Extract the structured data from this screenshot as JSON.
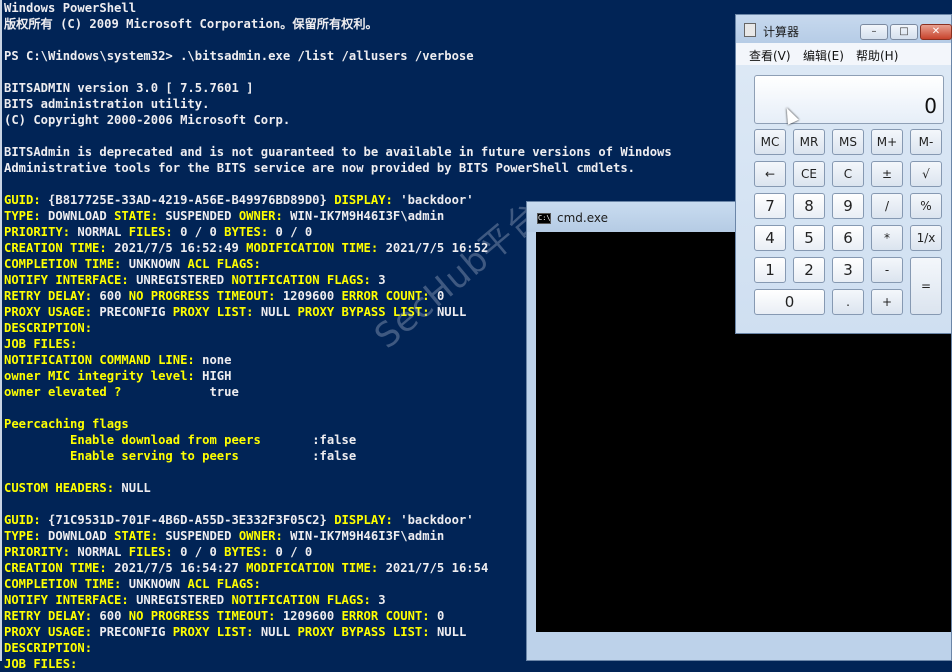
{
  "watermark": "SecHub平台",
  "powershell": {
    "lines": [
      "Windows PowerShell",
      "版权所有 (C) 2009 Microsoft Corporation。保留所有权利。",
      "",
      "PS C:\\Windows\\system32> .\\bitsadmin.exe /list /allusers /verbose",
      "",
      "BITSADMIN version 3.0 [ 7.5.7601 ]",
      "BITS administration utility.",
      "(C) Copyright 2000-2006 Microsoft Corp.",
      "",
      "BITSAdmin is deprecated and is not guaranteed to be available in future versions of Windows",
      "Administrative tools for the BITS service are now provided by BITS PowerShell cmdlets.",
      "",
      "GUID: {B817725E-33AD-4219-A56E-B49976BD89D0} DISPLAY: 'backdoor'",
      "TYPE: DOWNLOAD STATE: SUSPENDED OWNER: WIN-IK7M9H46I3F\\admin",
      "PRIORITY: NORMAL FILES: 0 / 0 BYTES: 0 / 0",
      "CREATION TIME: 2021/7/5 16:52:49 MODIFICATION TIME: 2021/7/5 16:52",
      "COMPLETION TIME: UNKNOWN ACL FLAGS:",
      "NOTIFY INTERFACE: UNREGISTERED NOTIFICATION FLAGS: 3",
      "RETRY DELAY: 600 NO PROGRESS TIMEOUT: 1209600 ERROR COUNT: 0",
      "PROXY USAGE: PRECONFIG PROXY LIST: NULL PROXY BYPASS LIST: NULL",
      "DESCRIPTION:",
      "JOB FILES:",
      "NOTIFICATION COMMAND LINE: none",
      "owner MIC integrity level: HIGH",
      "owner elevated ?            true",
      "",
      "Peercaching flags",
      "         Enable download from peers       :false",
      "         Enable serving to peers          :false",
      "",
      "CUSTOM HEADERS: NULL",
      "",
      "GUID: {71C9531D-701F-4B6D-A55D-3E332F3F05C2} DISPLAY: 'backdoor'",
      "TYPE: DOWNLOAD STATE: SUSPENDED OWNER: WIN-IK7M9H46I3F\\admin",
      "PRIORITY: NORMAL FILES: 0 / 0 BYTES: 0 / 0",
      "CREATION TIME: 2021/7/5 16:54:27 MODIFICATION TIME: 2021/7/5 16:54",
      "COMPLETION TIME: UNKNOWN ACL FLAGS:",
      "NOTIFY INTERFACE: UNREGISTERED NOTIFICATION FLAGS: 3",
      "RETRY DELAY: 600 NO PROGRESS TIMEOUT: 1209600 ERROR COUNT: 0",
      "PROXY USAGE: PRECONFIG PROXY LIST: NULL PROXY BYPASS LIST: NULL",
      "DESCRIPTION:",
      "JOB FILES:"
    ],
    "yellow_keywords": [
      "GUID:",
      "DISPLAY:",
      "TYPE:",
      "STATE:",
      "OWNER:",
      "PRIORITY:",
      "FILES:",
      "BYTES:",
      "CREATION TIME:",
      "MODIFICATION TIME:",
      "COMPLETION TIME:",
      "ACL FLAGS:",
      "NOTIFY INTERFACE:",
      "NOTIFICATION FLAGS:",
      "RETRY DELAY:",
      "NO PROGRESS TIMEOUT:",
      "ERROR COUNT:",
      "PROXY USAGE:",
      "PROXY LIST:",
      "PROXY BYPASS LIST:",
      "DESCRIPTION:",
      "JOB FILES:",
      "NOTIFICATION COMMAND LINE:",
      "owner MIC integrity level:",
      "owner elevated ?",
      "Peercaching flags",
      "Enable download from peers",
      "Enable serving to peers",
      "CUSTOM HEADERS:"
    ],
    "colors": {
      "background": "#012456",
      "text": "#eeedf0",
      "keyword": "#ffff00"
    }
  },
  "cmd_window": {
    "title": "cmd.exe",
    "icon_text": "C:\\",
    "icon": "console-icon"
  },
  "calculator": {
    "title": "计算器",
    "menu": [
      "查看(V)",
      "编辑(E)",
      "帮助(H)"
    ],
    "window_buttons": [
      "minimize-icon",
      "maximize-icon",
      "close-icon"
    ],
    "display_value": "0",
    "keys": {
      "row1": [
        "MC",
        "MR",
        "MS",
        "M+",
        "M-"
      ],
      "row2": [
        "←",
        "CE",
        "C",
        "±",
        "√"
      ],
      "row3": [
        "7",
        "8",
        "9",
        "/",
        "%"
      ],
      "row4": [
        "4",
        "5",
        "6",
        "*",
        "1/x"
      ],
      "row5": [
        "1",
        "2",
        "3",
        "-",
        "="
      ],
      "row6": [
        "0",
        ".",
        "+"
      ]
    }
  }
}
